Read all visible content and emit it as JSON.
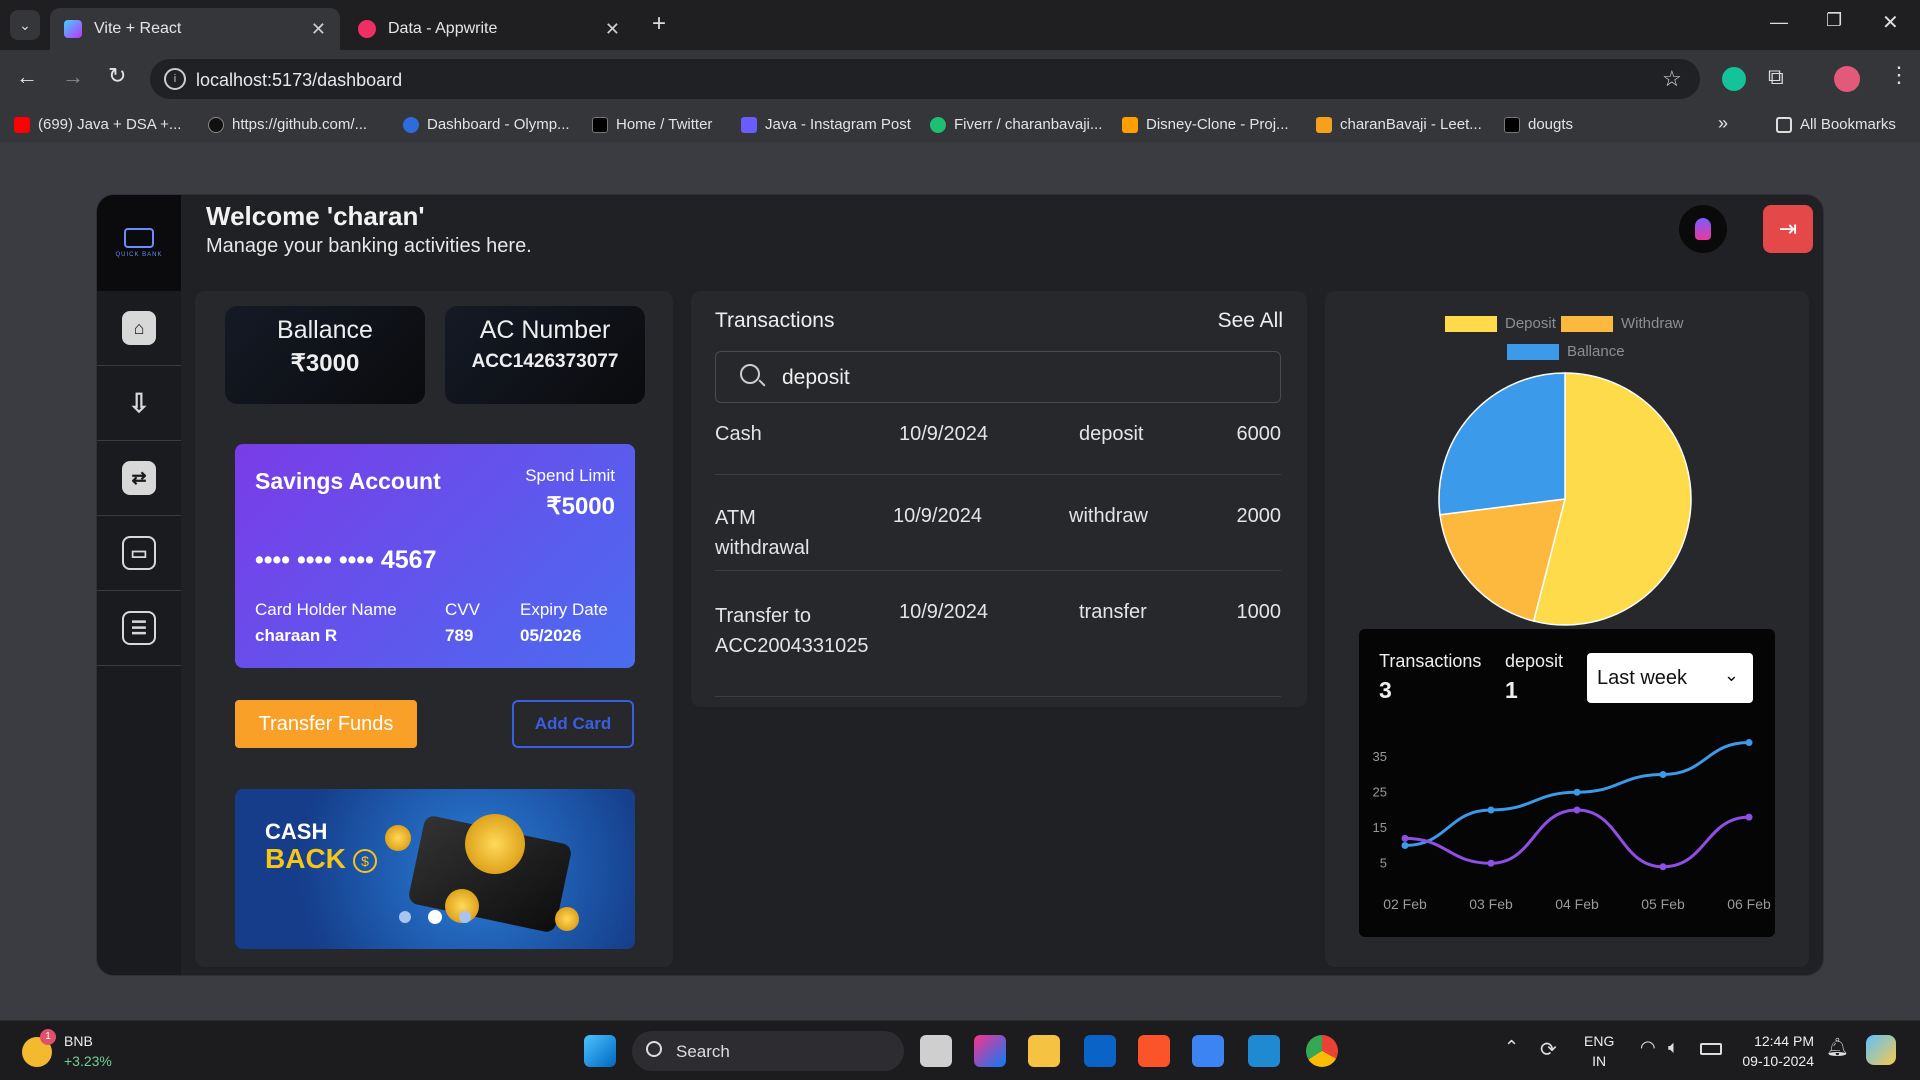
{
  "browser": {
    "tabs": [
      {
        "title": "Vite + React",
        "active": true
      },
      {
        "title": "Data - Appwrite",
        "active": false
      }
    ],
    "url": "localhost:5173/dashboard",
    "bookmarks": [
      "(699) Java + DSA +...",
      "https://github.com/...",
      "Dashboard - Olymp...",
      "Home / Twitter",
      "Java - Instagram Post",
      "Fiverr / charanbavaji...",
      "Disney-Clone - Proj...",
      "charanBavaji - Leet...",
      "dougts"
    ],
    "all_bookmarks": "All Bookmarks"
  },
  "header": {
    "welcome": "Welcome 'charan'",
    "subtitle": "Manage your banking activities here.",
    "logo_text": "QUICK BANK"
  },
  "balance": {
    "label": "Ballance",
    "value": "₹3000"
  },
  "account": {
    "label": "AC Number",
    "value": "ACC1426373077"
  },
  "card": {
    "type": "Savings Account",
    "spend_label": "Spend Limit",
    "spend_value": "₹5000",
    "number": "•••• •••• •••• 4567",
    "holder_label": "Card Holder Name",
    "holder_value": "charaan R",
    "cvv_label": "CVV",
    "cvv_value": "789",
    "expiry_label": "Expiry Date",
    "expiry_value": "05/2026"
  },
  "buttons": {
    "transfer": "Transfer Funds",
    "add_card": "Add Card"
  },
  "banner": {
    "line1": "CASH",
    "line2": "BACK"
  },
  "transactions": {
    "title": "Transactions",
    "see_all": "See All",
    "search_value": "deposit",
    "rows": [
      {
        "desc": "Cash",
        "date": "10/9/2024",
        "type": "deposit",
        "amount": "6000"
      },
      {
        "desc": "ATM withdrawal",
        "date": "10/9/2024",
        "type": "withdraw",
        "amount": "2000"
      },
      {
        "desc": "Transfer to ACC2004331025",
        "date": "10/9/2024",
        "type": "transfer",
        "amount": "1000"
      }
    ]
  },
  "pie": {
    "legend": [
      "Deposit",
      "Withdraw",
      "Ballance"
    ],
    "colors": [
      "#fedb4a",
      "#fdb93e",
      "#3b9ae9"
    ],
    "values": [
      54,
      19,
      27
    ]
  },
  "stats": {
    "tx_label": "Transactions",
    "tx_value": "3",
    "dep_label": "deposit",
    "dep_value": "1",
    "period": "Last week"
  },
  "chart_data": {
    "type": "line",
    "x": [
      "02 Feb",
      "03 Feb",
      "04 Feb",
      "05 Feb",
      "06 Feb"
    ],
    "yticks": [
      5,
      15,
      25,
      35
    ],
    "ylim": [
      0,
      40
    ],
    "series": [
      {
        "color": "#3b9ae9",
        "values": [
          10,
          20,
          25,
          30,
          39
        ]
      },
      {
        "color": "#8f4fe6",
        "values": [
          12,
          5,
          20,
          4,
          18
        ]
      }
    ]
  },
  "taskbar": {
    "coin": "BNB",
    "change": "+3.23%",
    "badge": "1",
    "search": "Search",
    "lang1": "ENG",
    "lang2": "IN",
    "time": "12:44 PM",
    "date": "09-10-2024"
  }
}
